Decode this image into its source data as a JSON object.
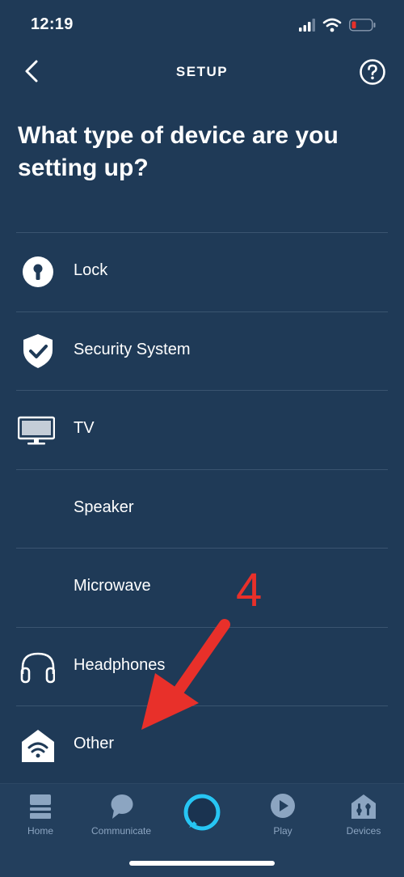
{
  "status_bar": {
    "time": "12:19"
  },
  "header": {
    "title": "SETUP"
  },
  "heading": "What type of device are you setting up?",
  "devices": [
    {
      "label": "Lock",
      "icon": "lock-icon"
    },
    {
      "label": "Security System",
      "icon": "shield-check-icon"
    },
    {
      "label": "TV",
      "icon": "tv-icon"
    },
    {
      "label": "Speaker",
      "icon": ""
    },
    {
      "label": "Microwave",
      "icon": ""
    },
    {
      "label": "Headphones",
      "icon": "headphones-icon"
    },
    {
      "label": "Other",
      "icon": "smart-home-wifi-icon"
    }
  ],
  "annotation": {
    "number": "4",
    "color": "#e8302a"
  },
  "tabs": [
    {
      "label": "Home",
      "icon": "home-icon"
    },
    {
      "label": "Communicate",
      "icon": "chat-bubble-icon"
    },
    {
      "label": "",
      "icon": "alexa-ring-icon"
    },
    {
      "label": "Play",
      "icon": "play-icon"
    },
    {
      "label": "Devices",
      "icon": "devices-icon"
    }
  ],
  "colors": {
    "background": "#1f3a57",
    "alexa_accent": "#27c5f3",
    "tab_inactive": "#8ca5c1",
    "battery_low": "#e8302a"
  }
}
